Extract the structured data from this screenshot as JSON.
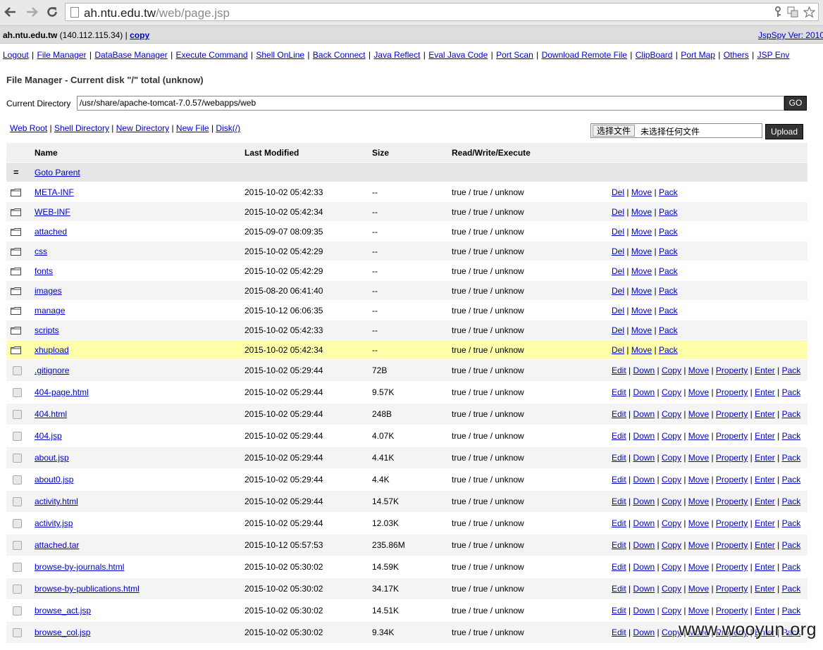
{
  "browser": {
    "url_host": "ah.ntu.edu.tw",
    "url_path": "/web/page.jsp"
  },
  "header": {
    "host": "ah.ntu.edu.tw",
    "ip": "(140.112.115.34)",
    "sep": "|",
    "copy_label": "copy",
    "version": "JspSpy Ver: 2010"
  },
  "menu": [
    "Logout",
    "File Manager",
    "DataBase Manager",
    "Execute Command",
    "Shell OnLine",
    "Back Connect",
    "Java Reflect",
    "Eval Java Code",
    "Port Scan",
    "Download Remote File",
    "ClipBoard",
    "Port Map",
    "Others",
    "JSP Env"
  ],
  "file_manager": {
    "title": "File Manager - Current disk \"/\" total (unknow)",
    "current_dir_label": "Current Directory",
    "current_dir_value": "/usr/share/apache-tomcat-7.0.57/webapps/web",
    "go_label": "GO",
    "tool_links": [
      "Web Root",
      "Shell Directory",
      "New Directory",
      "New File",
      "Disk(/)"
    ],
    "choose_file_label": "选择文件",
    "no_file_label": "未选择任何文件",
    "upload_label": "Upload"
  },
  "table": {
    "headers": {
      "name": "Name",
      "modified": "Last Modified",
      "size": "Size",
      "rwx": "Read/Write/Execute"
    },
    "parent_label": "Goto Parent",
    "parent_icon": "=",
    "dir_actions": [
      "Del",
      "Move",
      "Pack"
    ],
    "file_actions": [
      "Edit",
      "Down",
      "Copy",
      "Move",
      "Property",
      "Enter",
      "Pack"
    ],
    "dirs": [
      {
        "name": "META-INF",
        "modified": "2015-10-02 05:42:33",
        "size": "--",
        "rwx": "true / true / unknow"
      },
      {
        "name": "WEB-INF",
        "modified": "2015-10-02 05:42:34",
        "size": "--",
        "rwx": "true / true / unknow"
      },
      {
        "name": "attached",
        "modified": "2015-09-07 08:09:35",
        "size": "--",
        "rwx": "true / true / unknow"
      },
      {
        "name": "css",
        "modified": "2015-10-02 05:42:29",
        "size": "--",
        "rwx": "true / true / unknow"
      },
      {
        "name": "fonts",
        "modified": "2015-10-02 05:42:29",
        "size": "--",
        "rwx": "true / true / unknow"
      },
      {
        "name": "images",
        "modified": "2015-08-20 06:41:40",
        "size": "--",
        "rwx": "true / true / unknow"
      },
      {
        "name": "manage",
        "modified": "2015-10-12 06:06:35",
        "size": "--",
        "rwx": "true / true / unknow"
      },
      {
        "name": "scripts",
        "modified": "2015-10-02 05:42:33",
        "size": "--",
        "rwx": "true / true / unknow"
      },
      {
        "name": "xhupload",
        "modified": "2015-10-02 05:42:34",
        "size": "--",
        "rwx": "true / true / unknow",
        "highlight": true
      }
    ],
    "files": [
      {
        "name": ".gitignore",
        "modified": "2015-10-02 05:29:44",
        "size": "72B",
        "rwx": "true / true / unknow"
      },
      {
        "name": "404-page.html",
        "modified": "2015-10-02 05:29:44",
        "size": "9.57K",
        "rwx": "true / true / unknow"
      },
      {
        "name": "404.html",
        "modified": "2015-10-02 05:29:44",
        "size": "248B",
        "rwx": "true / true / unknow"
      },
      {
        "name": "404.jsp",
        "modified": "2015-10-02 05:29:44",
        "size": "4.07K",
        "rwx": "true / true / unknow"
      },
      {
        "name": "about.jsp",
        "modified": "2015-10-02 05:29:44",
        "size": "4.41K",
        "rwx": "true / true / unknow"
      },
      {
        "name": "about0.jsp",
        "modified": "2015-10-02 05:29:44",
        "size": "4.4K",
        "rwx": "true / true / unknow"
      },
      {
        "name": "activity.html",
        "modified": "2015-10-02 05:29:44",
        "size": "14.57K",
        "rwx": "true / true / unknow"
      },
      {
        "name": "activity.jsp",
        "modified": "2015-10-02 05:29:44",
        "size": "12.03K",
        "rwx": "true / true / unknow"
      },
      {
        "name": "attached.tar",
        "modified": "2015-10-12 05:57:53",
        "size": "235.86M",
        "rwx": "true / true / unknow"
      },
      {
        "name": "browse-by-journals.html",
        "modified": "2015-10-02 05:30:02",
        "size": "14.59K",
        "rwx": "true / true / unknow"
      },
      {
        "name": "browse-by-publications.html",
        "modified": "2015-10-02 05:30:02",
        "size": "34.17K",
        "rwx": "true / true / unknow"
      },
      {
        "name": "browse_act.jsp",
        "modified": "2015-10-02 05:30:02",
        "size": "14.51K",
        "rwx": "true / true / unknow"
      },
      {
        "name": "browse_col.jsp",
        "modified": "2015-10-02 05:30:02",
        "size": "9.34K",
        "rwx": "true / true / unknow"
      }
    ]
  },
  "watermark": "www.wooyun.org"
}
